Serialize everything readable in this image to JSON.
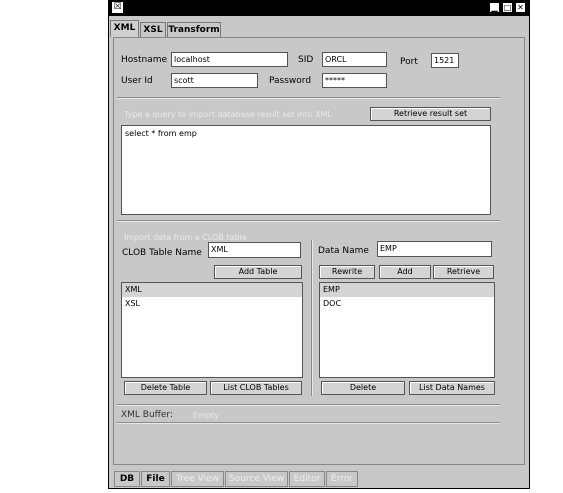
{
  "window": {
    "icon_glyph": "☒",
    "minimize_glyph": "▁",
    "maximize_glyph": "□",
    "close_glyph": "✕"
  },
  "tabs": [
    {
      "label": "XML",
      "active": true
    },
    {
      "label": "XSL",
      "active": false
    },
    {
      "label": "Transform",
      "active": false
    }
  ],
  "connection": {
    "hostname_label": "Hostname",
    "hostname_value": "localhost",
    "sid_label": "SID",
    "sid_value": "ORCL",
    "port_label": "Port",
    "port_value": "1521",
    "userid_label": "User Id",
    "userid_value": "scott",
    "password_label": "Password",
    "password_value": "*****"
  },
  "query": {
    "hint": "Type a query to import database result set into XML",
    "retrieve_button": "Retrieve result set",
    "text": "select * from emp"
  },
  "clob": {
    "hint": "Import data from a CLOB table",
    "table_name_label": "CLOB Table Name",
    "table_name_value": "XML",
    "add_table_button": "Add Table",
    "items": [
      "XML",
      "XSL"
    ],
    "delete_table_button": "Delete Table",
    "list_tables_button": "List CLOB Tables"
  },
  "data": {
    "name_label": "Data Name",
    "name_value": "EMP",
    "rewrite_button": "Rewrite",
    "add_button": "Add",
    "retrieve_button": "Retrieve",
    "items": [
      "EMP",
      "DOC"
    ],
    "delete_button": "Delete",
    "list_names_button": "List Data Names"
  },
  "buffer": {
    "label": "XML Buffer:",
    "value": "Empty"
  },
  "bottom_tabs": [
    {
      "label": "DB",
      "enabled": true
    },
    {
      "label": "File",
      "enabled": true
    },
    {
      "label": "Tree View",
      "enabled": false
    },
    {
      "label": "Source View",
      "enabled": false
    },
    {
      "label": "Editor",
      "enabled": false
    },
    {
      "label": "Error",
      "enabled": false
    }
  ]
}
